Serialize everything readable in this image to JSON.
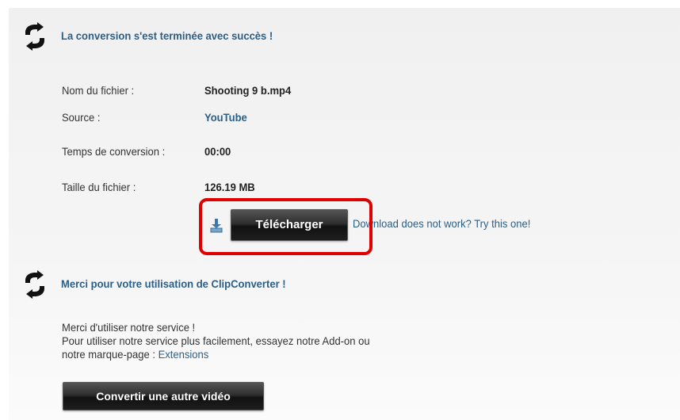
{
  "success": {
    "icon": "convert-arrows-icon",
    "heading": "La conversion s'est terminée avec succès !"
  },
  "details": {
    "filename_label": "Nom du fichier :",
    "filename_value": "Shooting 9 b.mp4",
    "source_label": "Source :",
    "source_value": "YouTube",
    "time_label": "Temps de conversion :",
    "time_value": "00:00",
    "size_label": "Taille du fichier :",
    "size_value": "126.19 MB"
  },
  "download": {
    "icon": "download-icon",
    "button_label": "Télécharger",
    "alt_link": "Download does not work? Try this one!",
    "highlight_color": "#e00000"
  },
  "thanks": {
    "icon": "convert-arrows-icon",
    "heading": "Merci pour votre utilisation de ClipConverter !",
    "line1": "Merci d'utiliser notre service !",
    "line2": "Pour utiliser notre service plus facilement, essayez notre Add-on ou",
    "line3_prefix": "notre marque-page : ",
    "line3_link": "Extensions",
    "convert_another_button": "Convertir une autre vidéo"
  },
  "colors": {
    "heading": "#2c5e86",
    "link": "#2c5e86",
    "button_dark": "#1e1e1e"
  }
}
